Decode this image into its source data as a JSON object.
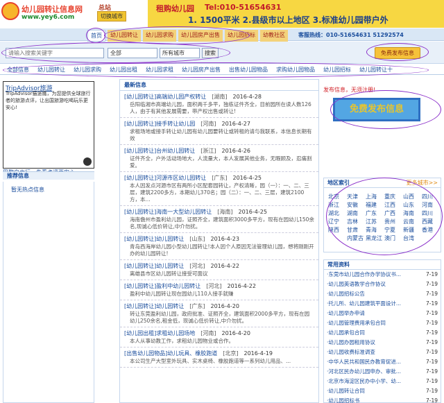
{
  "header": {
    "site_title": "幼儿园转让信息网",
    "site_url": "www.yey6.com",
    "site_label": "总站",
    "city_switch": "切换城市",
    "ad_title": "租购幼儿园",
    "ad_tel": "Tel:010-51654631",
    "ad_points": "1. 1500平米  2.县级市以上地区  3.标准幼儿园带户外"
  },
  "nav": {
    "items": [
      "首页",
      "幼儿园转让",
      "幼儿园求购",
      "幼儿园房产出售",
      "幼儿园招标",
      "幼教社区"
    ],
    "hotline": "客服热线：010-51654631 51292574"
  },
  "search": {
    "placeholder": "请输入搜索关键字",
    "category": "全部",
    "city": "所有城市",
    "button": "搜索",
    "free_post": "免费发布信息"
  },
  "categories": [
    "全部信息",
    "幼儿园转让",
    "幼儿园求购",
    "幼儿园出租",
    "幼儿园求租",
    "幼儿园房产出售",
    "出售幼儿园物品",
    "求购幼儿园物品",
    "幼儿园招标",
    "幼儿园转让十"
  ],
  "left": {
    "ad_title": "TripAdvisor旅游",
    "ad_text": "TripAdvisor猫途鹰，为您提供全球旅行者的旅游点评，让出国旅游吃喝玩乐更安心!",
    "ad_link": "巴黎自由行，先看点评更安心",
    "rec_header": "推荐信息",
    "rec_empty": "暂无热点信息"
  },
  "center": {
    "head": "最新信息",
    "news": [
      {
        "title": "[幼儿园转让]高端幼儿园产权转让",
        "region": "[湖南]",
        "date": "2016-4-28",
        "desc": "岳阳临湘市高端幼儿园，面积两千多平，独栋证件齐全，目前园所在读人数126人，由于有其他发展需要，带产权出售或转让!"
      },
      {
        "title": "[幼儿园转让]接手转让幼儿园",
        "region": "[河南]",
        "date": "2016-4-27",
        "desc": "求租场地或接手转让幼儿园有幼儿园要转让或转租的请与我联系，本信息长期有效"
      },
      {
        "title": "[幼儿园转让]台州幼儿园转让",
        "region": "[浙江]",
        "date": "2016-4-26",
        "desc": "证件齐全，户外活动场地大，人流量大，本人发展其他业务，无暇顾及，忍痛割爱。"
      },
      {
        "title": "[幼儿园转让]河源市区幼儿园转让",
        "region": "[广东]",
        "date": "2016-4-25",
        "desc": "本人因发点河源市区有两所小区配套园转让，产权清晰，园（一）：一、二、三层，建筑2200多方，本期幼儿370名；园（二）：一、二、三层，建筑2100方，本..."
      },
      {
        "title": "[幼儿园转让]海南一大型幼儿园转让",
        "region": "[海南]",
        "date": "2016-4-25",
        "desc": "海南儋州市盈利幼儿园，证照齐全，建筑面积3000多平方，现有在园幼儿150余名,现诚心低价转让,中介勿扰。"
      },
      {
        "title": "[幼儿园转让]幼儿园转让",
        "region": "[山东]",
        "date": "2016-4-23",
        "desc": "青岛西海岸幼儿园小型幼儿园转让!本人因个人原因无法管理幼儿园，想将刚刚开办的幼儿园转让!"
      },
      {
        "title": "[幼儿园转让]幼儿园转让",
        "region": "[河北]",
        "date": "2016-4-22",
        "desc": "离雄县市区幼儿园转让接受可面议"
      },
      {
        "title": "[幼儿园转让]盈利中幼儿园转让",
        "region": "[河北]",
        "date": "2016-4-22",
        "desc": "盈利中幼儿园转让现在园幼儿110人接手就赚"
      },
      {
        "title": "[幼儿园转让]幼儿园转让",
        "region": "[广东]",
        "date": "2016-4-20",
        "desc": "转让东莞盈利幼儿园，政府批准、证照齐全，建筑面积2000多平方，现有在园幼儿250余名,租金低，现诚心低价转让,中介勿扰。"
      },
      {
        "title": "[幼儿园出租]求租幼儿园场地",
        "region": "[河南]",
        "date": "2016-4-20",
        "desc": "本人从事幼教工作，求租幼儿园物业或合作。"
      },
      {
        "title": "[出售幼儿园物品]幼儿玩具、橡胶跑道",
        "region": "[北京]",
        "date": "2016-4-19",
        "desc": "本公司生产大型室外玩具、实木桌椅、橡胶跑道等一系列幼儿用品、..."
      }
    ]
  },
  "right": {
    "post_prompt": "发布信息，无须注册!",
    "big_post": "免费发布信息",
    "region_head": "地区索引",
    "more_cities": "更多城市>>",
    "cities": [
      "北京",
      "天津",
      "上海",
      "重庆",
      "山西",
      "四川",
      "浙江",
      "安徽",
      "福建",
      "江西",
      "山东",
      "河南",
      "湖北",
      "湖南",
      "广东",
      "广西",
      "海南",
      "四川",
      "辽宁",
      "吉林",
      "江苏",
      "贵州",
      "云南",
      "西藏",
      "陕西",
      "甘肃",
      "青海",
      "宁夏",
      "新疆",
      "香港",
      "",
      "内蒙古",
      "黑龙江",
      "澳门",
      "台湾",
      ""
    ],
    "res_head": "常用资料",
    "resources": [
      {
        "title": "·东莞市幼儿园合作办学协议书...",
        "date": "7-19"
      },
      {
        "title": "·幼儿园英语教学合作协议",
        "date": "7-19"
      },
      {
        "title": "·幼儿园招标公告",
        "date": "7-19"
      },
      {
        "title": "·托儿所、幼儿园建筑平面设计...",
        "date": "7-19"
      },
      {
        "title": "·幼儿园举办申请",
        "date": "7-19"
      },
      {
        "title": "·幼儿园管理费用承包合同",
        "date": "7-19"
      },
      {
        "title": "·幼儿园承包合同",
        "date": "7-19"
      },
      {
        "title": "·幼儿园办园租用协议",
        "date": "7-19"
      },
      {
        "title": "·幼儿园收费标准调查",
        "date": "7-19"
      },
      {
        "title": "·中华人民共和国民办教育促进...",
        "date": "7-19"
      },
      {
        "title": "·河北区民办幼儿园申办、审批...",
        "date": "7-19"
      },
      {
        "title": "·北京市海淀区民办中小学、幼...",
        "date": "7-19"
      },
      {
        "title": "·幼儿园转让合同",
        "date": "7-19"
      },
      {
        "title": "·幼儿园招标书",
        "date": "7-19"
      }
    ]
  }
}
